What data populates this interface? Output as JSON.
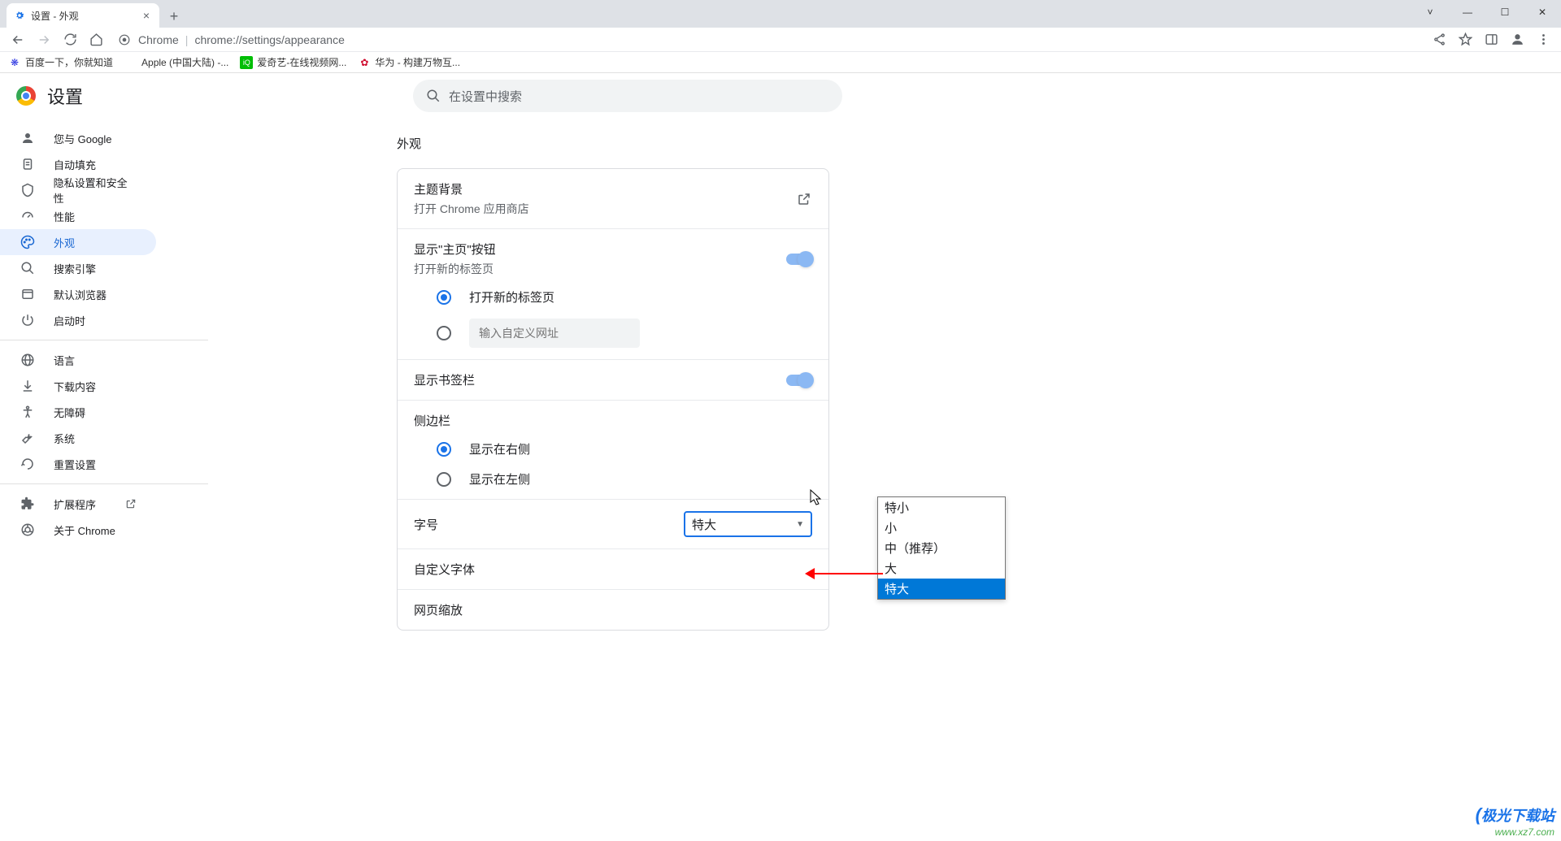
{
  "tab": {
    "title": "设置 - 外观"
  },
  "url": {
    "prefix": "Chrome",
    "path": "chrome://settings/appearance"
  },
  "bookmarks": [
    {
      "label": "百度一下，你就知道",
      "icon": "baidu",
      "color": "#2932e1"
    },
    {
      "label": "Apple (中国大陆) -...",
      "icon": "apple",
      "color": "#555"
    },
    {
      "label": "爱奇艺-在线视频网...",
      "icon": "iqiyi",
      "color": "#00be06"
    },
    {
      "label": "华为 - 构建万物互...",
      "icon": "huawei",
      "color": "#cf0a2c"
    }
  ],
  "settings_title": "设置",
  "search_placeholder": "在设置中搜索",
  "nav": [
    {
      "key": "you",
      "label": "您与 Google"
    },
    {
      "key": "autofill",
      "label": "自动填充"
    },
    {
      "key": "privacy",
      "label": "隐私设置和安全性"
    },
    {
      "key": "performance",
      "label": "性能"
    },
    {
      "key": "appearance",
      "label": "外观",
      "active": true
    },
    {
      "key": "search",
      "label": "搜索引擎"
    },
    {
      "key": "default",
      "label": "默认浏览器"
    },
    {
      "key": "startup",
      "label": "启动时"
    },
    {
      "key": "language",
      "label": "语言"
    },
    {
      "key": "downloads",
      "label": "下载内容"
    },
    {
      "key": "accessibility",
      "label": "无障碍"
    },
    {
      "key": "system",
      "label": "系统"
    },
    {
      "key": "reset",
      "label": "重置设置"
    },
    {
      "key": "extensions",
      "label": "扩展程序"
    },
    {
      "key": "about",
      "label": "关于 Chrome"
    }
  ],
  "section": {
    "title": "外观"
  },
  "rows": {
    "theme": {
      "title": "主题背景",
      "sub": "打开 Chrome 应用商店"
    },
    "home": {
      "title": "显示\"主页\"按钮",
      "sub": "打开新的标签页"
    },
    "home_options": {
      "newtab": "打开新的标签页",
      "custom_placeholder": "输入自定义网址"
    },
    "bookmarksbar": {
      "title": "显示书签栏"
    },
    "sidepanel": {
      "title": "侧边栏",
      "right": "显示在右侧",
      "left": "显示在左侧"
    },
    "fontsize": {
      "title": "字号",
      "value": "特大"
    },
    "customfont": {
      "title": "自定义字体"
    },
    "zoom": {
      "title": "网页缩放"
    }
  },
  "dropdown": {
    "options": [
      "特小",
      "小",
      "中（推荐）",
      "大",
      "特大"
    ],
    "highlighted": "特大"
  },
  "watermark": {
    "top": "极光下载站",
    "url": "www.xz7.com"
  }
}
